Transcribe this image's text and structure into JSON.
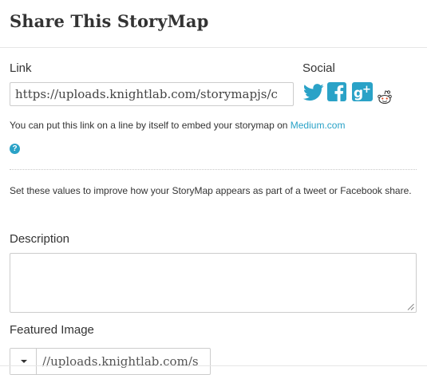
{
  "dialog": {
    "title": "Share This StoryMap"
  },
  "link": {
    "label": "Link",
    "value": "https://uploads.knightlab.com/storymapjs/c"
  },
  "social": {
    "label": "Social",
    "icons": [
      "twitter-icon",
      "facebook-icon",
      "google-plus-icon",
      "reddit-icon"
    ],
    "icon_color": "#2aa2c7"
  },
  "embed_help": {
    "text": "You can put this link on a line by itself to embed your storymap on ",
    "link_text": "Medium.com",
    "icon": "question-icon",
    "icon_glyph": "?"
  },
  "info": {
    "text": "Set these values to improve how your StoryMap appears as part of a tweet or Facebook share."
  },
  "description": {
    "label": "Description",
    "value": ""
  },
  "featured_image": {
    "label": "Featured Image",
    "value": "//uploads.knightlab.com/s"
  },
  "colors": {
    "accent": "#2aa2c7",
    "border": "#cccccc",
    "text": "#333333"
  }
}
